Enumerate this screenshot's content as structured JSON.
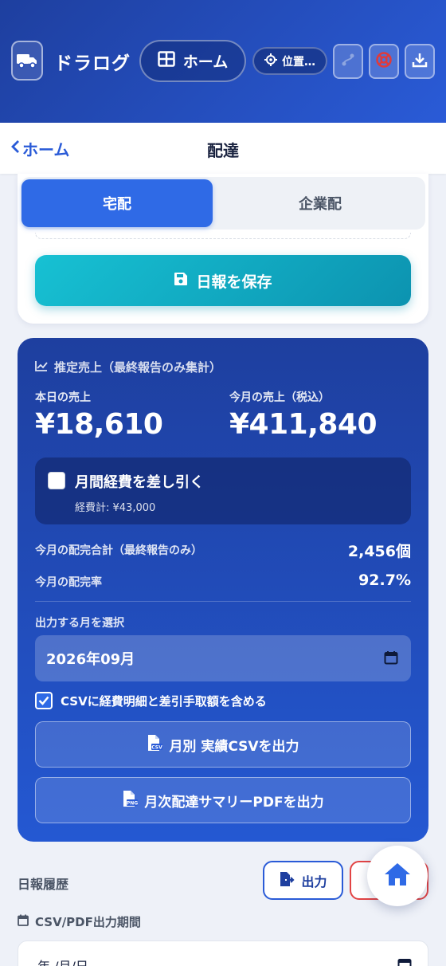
{
  "header": {
    "brand": "ドラログ",
    "home_label": "ホーム",
    "location_label": "位置…"
  },
  "nav": {
    "back_label": "ホーム",
    "title": "配達"
  },
  "tabs": [
    {
      "label": "宅配",
      "active": true
    },
    {
      "label": "企業配",
      "active": false
    }
  ],
  "save_button": "日報を保存",
  "sales": {
    "heading": "推定売上（最終報告のみ集計）",
    "today_label": "本日の売上",
    "today_value": "¥18,610",
    "month_label": "今月の売上（税込）",
    "month_value": "¥411,840",
    "expense_label": "月間経費を差し引く",
    "expense_total": "経費計: ¥43,000",
    "expense_checked": false,
    "delivered_label": "今月の配完合計（最終報告のみ）",
    "delivered_value": "2,456個",
    "rate_label": "今月の配完率",
    "rate_value": "92.7%",
    "month_select_label": "出力する月を選択",
    "month_select_value": "2026年09月",
    "csv_option_label": "CSVに経費明細と差引手取額を含める",
    "csv_option_checked": true,
    "csv_button": "月別 実績CSVを出力",
    "pdf_button": "月次配達サマリーPDFを出力"
  },
  "history": {
    "title": "日報履歴",
    "output_button": "出力",
    "period_label": "CSV/PDF出力期間",
    "date_placeholder": "年 /月/日"
  },
  "colors": {
    "header_bg": "#1e3f9f",
    "accent": "#2f6ae6",
    "save_btn": "#17c1d3",
    "danger": "#e24444"
  }
}
